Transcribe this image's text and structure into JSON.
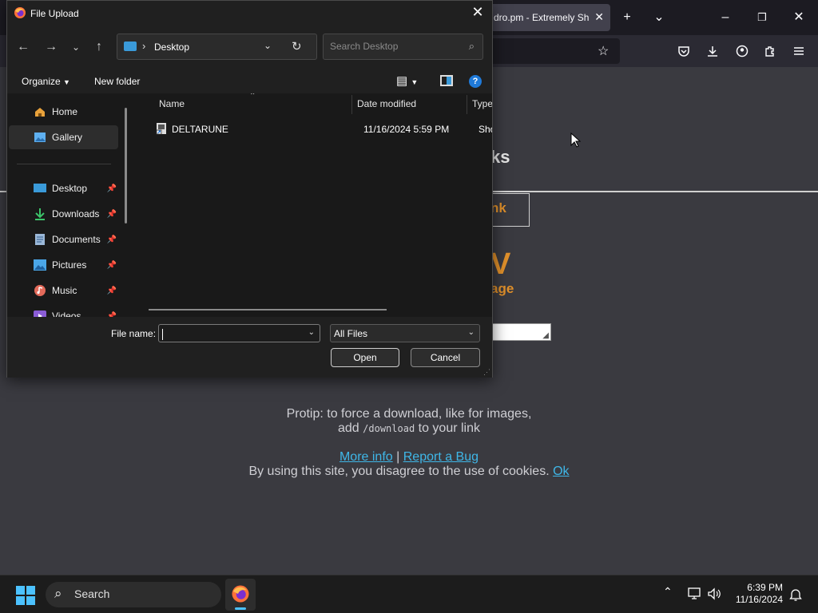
{
  "browser": {
    "tab_title": "dro.pm - Extremely Sh",
    "page": {
      "heading_fragment": "ks",
      "link_button_fragment": "nk",
      "big_letter": "V",
      "image_fragment": "age",
      "protip_line1": "Protip: to force a download, like for images,",
      "protip_add": "add",
      "protip_code": "/download",
      "protip_end": "to your link",
      "more_info": "More info",
      "separator": "|",
      "report_bug": "Report a Bug",
      "cookies_text": "By using this site, you disagree to the use of cookies.",
      "cookies_ok": "Ok"
    }
  },
  "dialog": {
    "title": "File Upload",
    "address": {
      "location": "Desktop"
    },
    "search": {
      "placeholder": "Search Desktop"
    },
    "toolbar": {
      "organize": "Organize",
      "new_folder": "New folder"
    },
    "nav_items": [
      {
        "label": "Home",
        "icon": "home-icon"
      },
      {
        "label": "Gallery",
        "icon": "gallery-icon",
        "selected": true
      },
      {
        "label": "Desktop",
        "icon": "desktop-icon",
        "pinned": true
      },
      {
        "label": "Downloads",
        "icon": "downloads-icon",
        "pinned": true
      },
      {
        "label": "Documents",
        "icon": "documents-icon",
        "pinned": true
      },
      {
        "label": "Pictures",
        "icon": "pictures-icon",
        "pinned": true
      },
      {
        "label": "Music",
        "icon": "music-icon",
        "pinned": true
      },
      {
        "label": "Videos",
        "icon": "videos-icon",
        "pinned": true
      }
    ],
    "columns": {
      "name": "Name",
      "date": "Date modified",
      "type": "Type"
    },
    "files": [
      {
        "name": "DELTARUNE",
        "date": "11/16/2024 5:59 PM",
        "type": "Short"
      }
    ],
    "filename_label": "File name:",
    "filename_value": "",
    "filetype": "All Files",
    "open": "Open",
    "cancel": "Cancel"
  },
  "taskbar": {
    "search": "Search",
    "time": "6:39 PM",
    "date": "11/16/2024"
  },
  "colors": {
    "accent_orange": "#e0902b",
    "link_blue": "#3fb7e8",
    "dialog_bg": "#202020"
  }
}
